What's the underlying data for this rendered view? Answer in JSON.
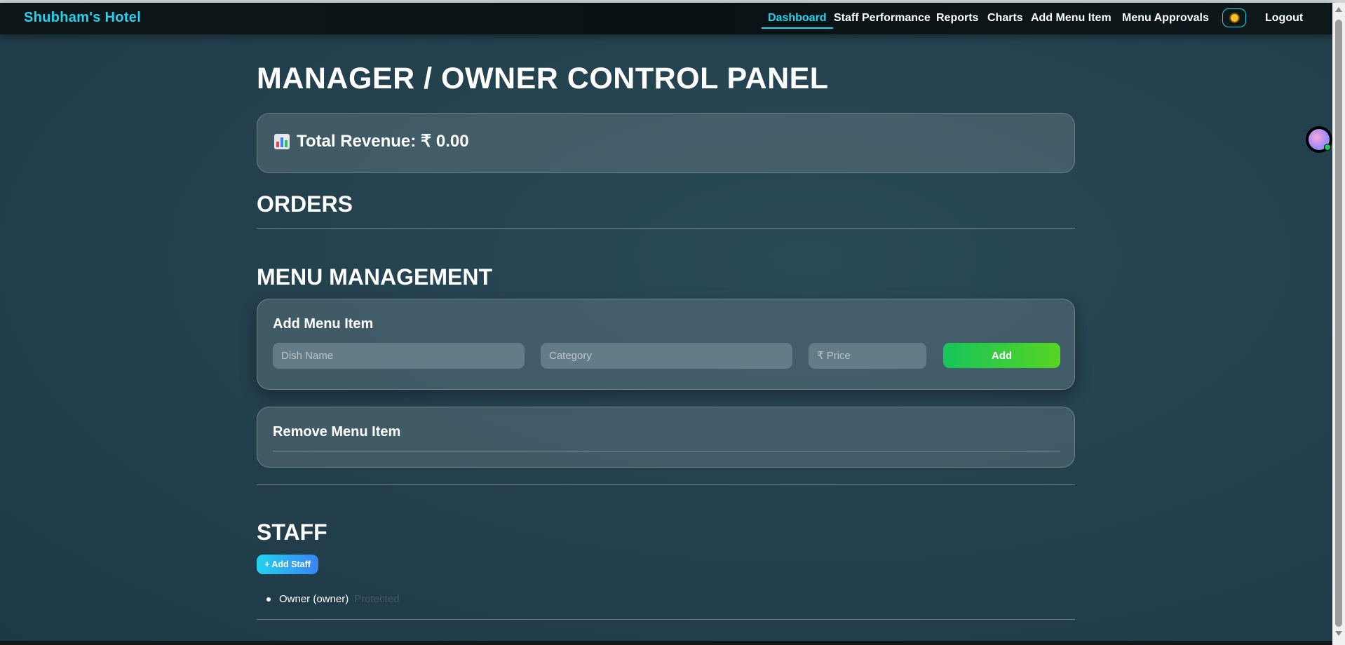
{
  "brand": "Shubham's Hotel",
  "nav": {
    "dashboard": "Dashboard",
    "staff_performance": "Staff Performance",
    "reports": "Reports",
    "charts": "Charts",
    "add_menu_item": "Add Menu Item",
    "menu_approvals": "Menu Approvals",
    "theme_icon": "sun-icon",
    "logout": "Logout"
  },
  "page_title": "MANAGER / OWNER CONTROL PANEL",
  "revenue": {
    "icon": "bar-chart-icon",
    "label": "Total Revenue: ₹ 0.00"
  },
  "orders": {
    "heading": "ORDERS"
  },
  "menu_management": {
    "heading": "MENU MANAGEMENT",
    "add_card": {
      "title": "Add Menu Item",
      "dish_name": {
        "value": "",
        "placeholder": "Dish Name"
      },
      "category": {
        "value": "",
        "placeholder": "Category"
      },
      "price": {
        "value": "",
        "placeholder": "₹ Price"
      },
      "add_button": "Add"
    },
    "remove_card": {
      "title": "Remove Menu Item"
    }
  },
  "staff": {
    "heading": "STAFF",
    "add_button": "+ Add Staff",
    "members": [
      {
        "name": "Owner (owner)",
        "status": "Protected"
      }
    ]
  },
  "colors": {
    "accent": "#22d3ee",
    "add_button_gradient": [
      "#16c55b",
      "#58d422"
    ],
    "add_staff_gradient": [
      "#22d3ee",
      "#3b82f6"
    ]
  }
}
